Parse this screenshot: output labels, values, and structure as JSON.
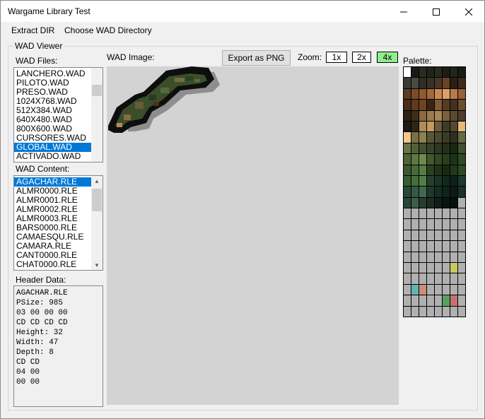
{
  "window": {
    "title": "Wargame Library Test"
  },
  "menu": {
    "items": [
      "Extract DIR",
      "Choose WAD Directory"
    ]
  },
  "viewer": {
    "legend": "WAD Viewer",
    "wad_files_label": "WAD Files:",
    "wad_files": [
      "LANCHERO.WAD",
      "PILOTO.WAD",
      "PRESO.WAD",
      "1024X768.WAD",
      "512X384.WAD",
      "640X480.WAD",
      "800X600.WAD",
      "CURSORES.WAD",
      "GLOBAL.WAD",
      "ACTIVADO.WAD"
    ],
    "wad_files_selected": "GLOBAL.WAD",
    "wad_content_label": "WAD Content:",
    "wad_content": [
      "AGACHAR.RLE",
      "ALMR0000.RLE",
      "ALMR0001.RLE",
      "ALMR0002.RLE",
      "ALMR0003.RLE",
      "BARS0000.RLE",
      "CAMAESQU.RLE",
      "CAMARA.RLE",
      "CANT0000.RLE",
      "CHAT0000.RLE"
    ],
    "wad_content_selected": "AGACHAR.RLE",
    "header_label": "Header Data:",
    "header_lines": [
      "AGACHAR.RLE",
      "PSize: 985",
      "03 00 00 00",
      "CD CD CD CD",
      "Height: 32",
      "Width: 47",
      "Depth: 8",
      "CD CD",
      "04 00",
      "00 00"
    ],
    "image_label": "WAD Image:",
    "export_label": "Export as PNG",
    "zoom_label": "Zoom:",
    "zoom_options": [
      "1x",
      "2x",
      "4x"
    ],
    "zoom_selected": "4x",
    "palette_label": "Palette:"
  },
  "palette_colors": [
    "#ffffff",
    "#1a1a14",
    "#2a2a22",
    "#1e2418",
    "#262a1e",
    "#1c1e16",
    "#20261c",
    "#181c14",
    "#3a3a36",
    "#4a4a44",
    "#2e2e28",
    "#3a3024",
    "#4a3626",
    "#6a4226",
    "#2a1e16",
    "#3e2a1c",
    "#5a3c22",
    "#7a4c28",
    "#8e5a30",
    "#a6683a",
    "#c88a52",
    "#daa066",
    "#b87a48",
    "#94623a",
    "#4a2c18",
    "#5e3a20",
    "#6e4426",
    "#3a2414",
    "#7e5a36",
    "#563a22",
    "#44301c",
    "#6a4e30",
    "#2e2014",
    "#3e2c1a",
    "#8a6a44",
    "#9c7a50",
    "#aa8656",
    "#7a6040",
    "#5a4a32",
    "#4a3e2a",
    "#1e1a12",
    "#2c2618",
    "#b08c58",
    "#c29a62",
    "#6c5a3c",
    "#403a28",
    "#54482e",
    "#e8b878",
    "#f0c888",
    "#7a7048",
    "#8a8254",
    "#5c5636",
    "#4a4a2e",
    "#3a3c26",
    "#2e3020",
    "#646c42",
    "#6a7446",
    "#52603a",
    "#445030",
    "#384428",
    "#2c3820",
    "#223018",
    "#1a2612",
    "#3e5030",
    "#4e6438",
    "#5e7842",
    "#708a4c",
    "#40582e",
    "#324a24",
    "#26401c",
    "#1c3416",
    "#304a26",
    "#3c5a30",
    "#486a38",
    "#567c44",
    "#2a4020",
    "#1e3418",
    "#162a12",
    "#22381c",
    "#2e4a28",
    "#3a5c32",
    "#466e3c",
    "#547e48",
    "#244030",
    "#1a3428",
    "#12281e",
    "#0e2018",
    "#1c3a2c",
    "#284a38",
    "#345a44",
    "#406a50",
    "#20382e",
    "#162c24",
    "#10221c",
    "#0c1a16",
    "#1a322a",
    "#2a463a",
    "#3c5e4c",
    "#283c30",
    "#1c2c24",
    "#101c18",
    "#0a1410",
    "#06100c",
    "#b0b0b0",
    "#b0b0b0",
    "#b0b0b0",
    "#b0b0b0",
    "#b0b0b0",
    "#b0b0b0",
    "#b0b0b0",
    "#b0b0b0",
    "#b0b0b0",
    "#b0b0b0",
    "#b0b0b0",
    "#b0b0b0",
    "#b0b0b0",
    "#b0b0b0",
    "#b0b0b0",
    "#b0b0b0",
    "#b0b0b0",
    "#b0b0b0",
    "#b0b0b0",
    "#b0b0b0",
    "#b0b0b0",
    "#b0b0b0",
    "#b0b0b0",
    "#b0b0b0",
    "#b0b0b0",
    "#b0b0b0",
    "#b0b0b0",
    "#b0b0b0",
    "#b0b0b0",
    "#b0b0b0",
    "#b0b0b0",
    "#b0b0b0",
    "#b0b0b0",
    "#b0b0b0",
    "#b0b0b0",
    "#b0b0b0",
    "#b0b0b0",
    "#b0b0b0",
    "#b0b0b0",
    "#b0b0b0",
    "#b0b0b0",
    "#b0b0b0",
    "#b0b0b0",
    "#b0b0b0",
    "#b0b0b0",
    "#b0b0b0",
    "#b0b0b0",
    "#c8c864",
    "#b0b0b0",
    "#b0b0b0",
    "#b0b0b0",
    "#b0b0b0",
    "#b0b0b0",
    "#b0b0b0",
    "#b0b0b0",
    "#b0b0b0",
    "#b0b0b0",
    "#b0b0b0",
    "#64b4b4",
    "#d08c78",
    "#b0b0b0",
    "#b0b0b0",
    "#b0b0b0",
    "#b0b0b0",
    "#b0b0b0",
    "#b0b0b0",
    "#b0b0b0",
    "#b0b0b0",
    "#b0b0b0",
    "#b0b0b0",
    "#5aa064",
    "#c87070",
    "#b0b0b0",
    "#b0b0b0",
    "#b0b0b0",
    "#b0b0b0",
    "#b0b0b0",
    "#b0b0b0",
    "#b0b0b0",
    "#b0b0b0",
    "#b0b0b0"
  ]
}
